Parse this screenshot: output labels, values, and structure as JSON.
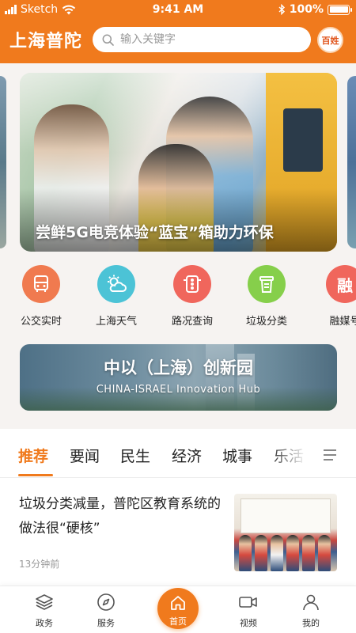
{
  "status_bar": {
    "carrier": "Sketch",
    "time": "9:41 AM",
    "battery": "100%",
    "battery_level": 1.0
  },
  "header": {
    "app_title": "上海普陀",
    "badge_text": "百姓",
    "search": {
      "placeholder": "输入关键字",
      "value": ""
    },
    "accent_color": "#f07a1d"
  },
  "banner": {
    "title": "尝鲜5G电竞体验“蓝宝”箱助力环保"
  },
  "shortcuts": [
    {
      "label": "公交实时",
      "icon": "bus-icon",
      "color": "#f07a4f"
    },
    {
      "label": "上海天气",
      "icon": "weather-icon",
      "color": "#4cc3d6"
    },
    {
      "label": "路况查询",
      "icon": "traffic-light-icon",
      "color": "#f0665c"
    },
    {
      "label": "垃圾分类",
      "icon": "trash-bin-icon",
      "color": "#86cf4b"
    },
    {
      "label": "融媒号",
      "icon_text": "融",
      "icon": "media-icon",
      "color": "#f0665c"
    }
  ],
  "hub_banner": {
    "title": "中以（上海）创新园",
    "subtitle": "CHINA-ISRAEL Innovation Hub"
  },
  "tabs": [
    {
      "label": "推荐",
      "active": true
    },
    {
      "label": "要闻",
      "active": false
    },
    {
      "label": "民生",
      "active": false
    },
    {
      "label": "经济",
      "active": false
    },
    {
      "label": "城事",
      "active": false
    },
    {
      "label": "乐活",
      "active": false
    }
  ],
  "article": {
    "title": "垃圾分类减量，普陀区教育系统的做法很“硬核”",
    "time": "13分钟前"
  },
  "bottom_nav": [
    {
      "label": "政务",
      "icon": "layers-icon"
    },
    {
      "label": "服务",
      "icon": "compass-icon"
    },
    {
      "label": "首页",
      "icon": "home-icon",
      "active": true
    },
    {
      "label": "视频",
      "icon": "video-camera-icon"
    },
    {
      "label": "我的",
      "icon": "user-icon"
    }
  ]
}
